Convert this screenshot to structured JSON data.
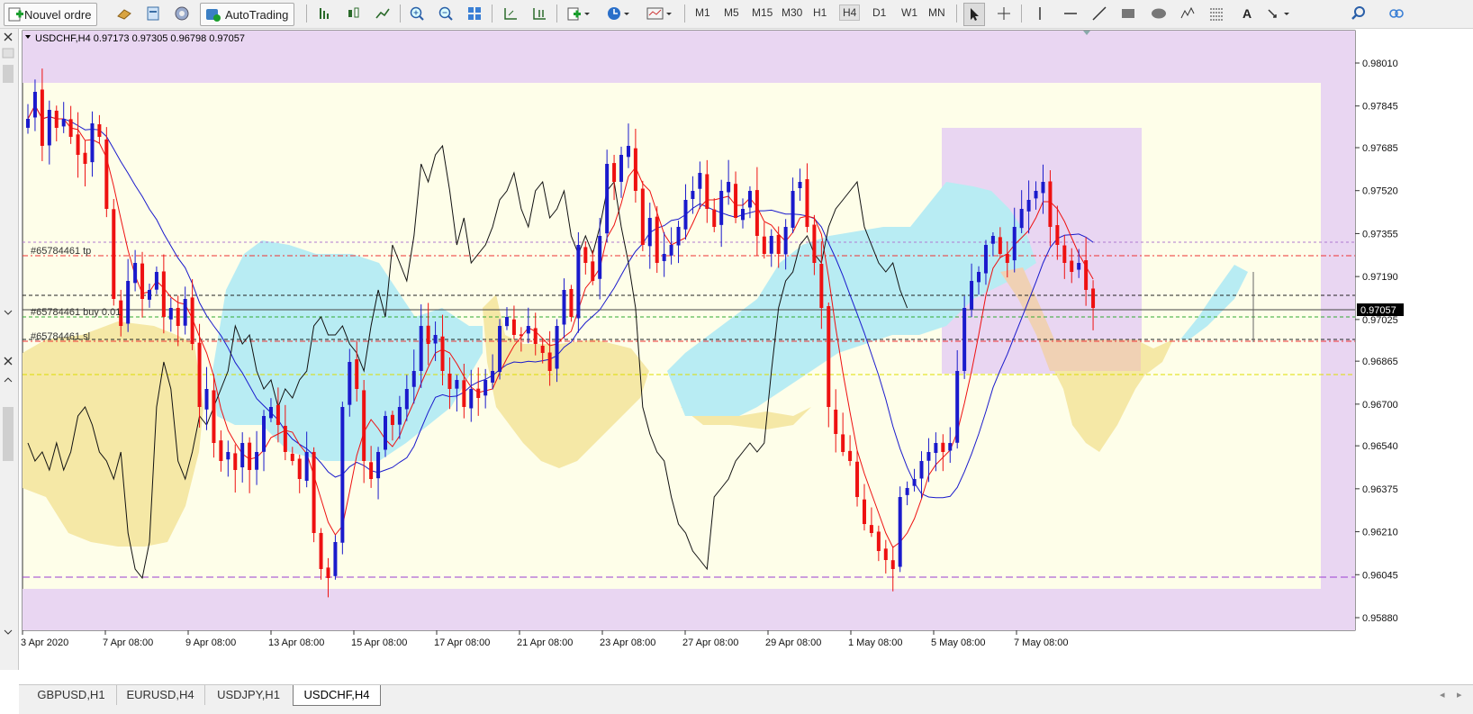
{
  "toolbar": {
    "new_order_label": "Nouvel ordre",
    "autotrading_label": "AutoTrading",
    "timeframes": [
      "M1",
      "M5",
      "M15",
      "M30",
      "H1",
      "H4",
      "D1",
      "W1",
      "MN"
    ],
    "active_timeframe": "H4"
  },
  "chart": {
    "header": "USDCHF,H4  0.97173 0.97305 0.96798 0.97057",
    "current_price": "0.97057",
    "price_ticks": [
      "0.98010",
      "0.97845",
      "0.97685",
      "0.97520",
      "0.97355",
      "0.97190",
      "0.97025",
      "0.96865",
      "0.96700",
      "0.96540",
      "0.96375",
      "0.96210",
      "0.96045",
      "0.95880"
    ],
    "date_ticks": [
      "3 Apr 2020",
      "7 Apr 08:00",
      "9 Apr 08:00",
      "13 Apr 08:00",
      "15 Apr 08:00",
      "17 Apr 08:00",
      "21 Apr 08:00",
      "23 Apr 08:00",
      "27 Apr 08:00",
      "29 Apr 08:00",
      "1 May 08:00",
      "5 May 08:00",
      "7 May 08:00"
    ],
    "order_labels": {
      "tp": "#65784461 tp",
      "buy": "#65784461 buy 0.01",
      "sl": "#65784461 sl"
    },
    "colors": {
      "bull": "#1a1acc",
      "bear": "#ee1111",
      "tenkan": "#ee1111",
      "kijun": "#1a1acc",
      "chikou": "#111111",
      "kumo_bull": "#b8ecf3",
      "kumo_bear": "#f5e8a6",
      "zone": "#e9d6f2",
      "plot_bg": "#fefee9"
    }
  },
  "tabs": [
    "GBPUSD,H1",
    "EURUSD,H4",
    "USDJPY,H1",
    "USDCHF,H4"
  ],
  "active_tab": "USDCHF,H4"
}
